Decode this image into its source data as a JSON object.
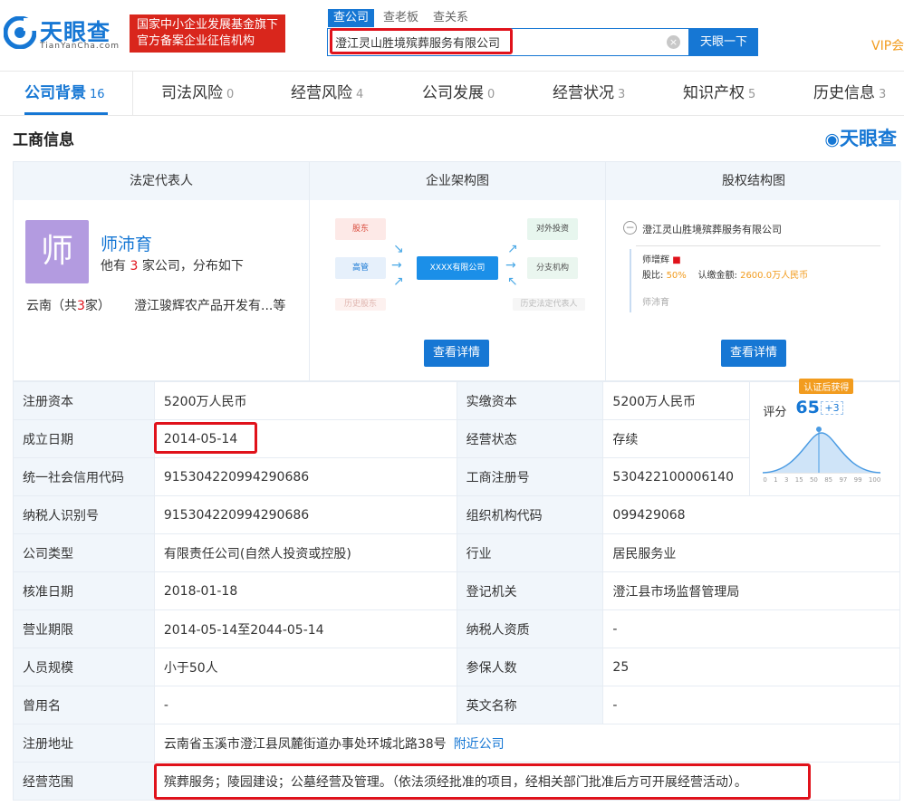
{
  "header": {
    "logo_text": "天眼查",
    "logo_sub": "TianYanCha.com",
    "fund_badge_line1": "国家中小企业发展基金旗下",
    "fund_badge_line2": "官方备案企业征信机构",
    "search_tabs": [
      "查公司",
      "查老板",
      "查关系"
    ],
    "search_value": "澄江灵山胜境殡葬服务有限公司",
    "search_button": "天眼一下",
    "vip": "VIP会"
  },
  "nav": [
    {
      "label": "公司背景",
      "count": "16"
    },
    {
      "label": "司法风险",
      "count": "0"
    },
    {
      "label": "经营风险",
      "count": "4"
    },
    {
      "label": "公司发展",
      "count": "0"
    },
    {
      "label": "经营状况",
      "count": "3"
    },
    {
      "label": "知识产权",
      "count": "5"
    },
    {
      "label": "历史信息",
      "count": "3"
    }
  ],
  "section_title": "工商信息",
  "brand_mark": "天眼查",
  "panels": {
    "legal_rep": {
      "title": "法定代表人",
      "avatar_char": "师",
      "name": "师沛育",
      "desc_pre": "他有",
      "desc_num": "3",
      "desc_post": "家公司，分布如下",
      "region_pre": "云南（共",
      "region_num": "3",
      "region_post": "家）",
      "company": "澄江骏辉农产品开发有...等"
    },
    "org_chart": {
      "title": "企业架构图",
      "left": [
        "股东",
        "高管",
        "历史股东"
      ],
      "center": "XXXX有限公司",
      "right": [
        "对外投资",
        "分支机构",
        "历史法定代表人"
      ],
      "button": "查看详情"
    },
    "equity": {
      "title": "股权结构图",
      "company": "澄江灵山胜境殡葬服务有限公司",
      "holder1_name": "师增辉",
      "holder1_ratio_label": "股比:",
      "holder1_ratio": "50%",
      "holder1_amount_label": "认缴金额:",
      "holder1_amount": "2600.0万人民币",
      "holder2_name": "师沛育",
      "button": "查看详情"
    }
  },
  "score": {
    "badge": "认证后获得",
    "label": "评分",
    "value": "65",
    "plus": "+3",
    "axis_ticks": [
      "0",
      "1",
      "3",
      "15",
      "50",
      "85",
      "97",
      "99",
      "100"
    ]
  },
  "rows": [
    {
      "l1": "注册资本",
      "v1": "5200万人民币",
      "l2": "实缴资本",
      "v2": "5200万人民币"
    },
    {
      "l1": "成立日期",
      "v1": "2014-05-14",
      "l2": "经营状态",
      "v2": "存续"
    },
    {
      "l1": "统一社会信用代码",
      "v1": "915304220994290686",
      "l2": "工商注册号",
      "v2": "530422100006140"
    },
    {
      "l1": "纳税人识别号",
      "v1": "915304220994290686",
      "l2": "组织机构代码",
      "v2": "099429068"
    },
    {
      "l1": "公司类型",
      "v1": "有限责任公司(自然人投资或控股)",
      "l2": "行业",
      "v2": "居民服务业"
    },
    {
      "l1": "核准日期",
      "v1": "2018-01-18",
      "l2": "登记机关",
      "v2": "澄江县市场监督管理局"
    },
    {
      "l1": "营业期限",
      "v1": "2014-05-14至2044-05-14",
      "l2": "纳税人资质",
      "v2": "-"
    },
    {
      "l1": "人员规模",
      "v1": "小于50人",
      "l2": "参保人数",
      "v2": "25"
    },
    {
      "l1": "曾用名",
      "v1": "-",
      "l2": "英文名称",
      "v2": "-"
    }
  ],
  "address": {
    "label": "注册地址",
    "value": "云南省玉溪市澄江县凤麓街道办事处环城北路38号",
    "link": "附近公司"
  },
  "scope": {
    "label": "经营范围",
    "value": "殡葬服务；陵园建设；公墓经营及管理。（依法须经批准的项目，经相关部门批准后方可开展经营活动）。"
  },
  "colors": {
    "brand": "#1677d4",
    "highlight": "#e0121b",
    "badge_red": "#d9261c",
    "accent_orange": "#f29c1f"
  }
}
